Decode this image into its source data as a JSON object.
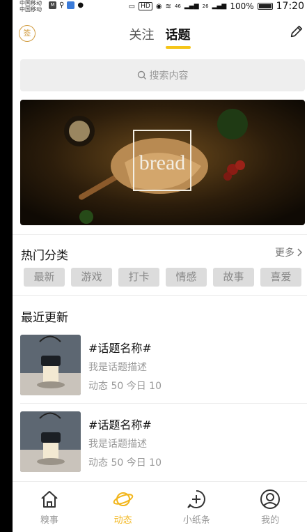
{
  "status_bar": {
    "carrier1": "中国移动",
    "carrier2": "中国移动",
    "hd": "HD",
    "signal1": "46",
    "signal2": "26",
    "battery_pct": "100%",
    "time": "17:20"
  },
  "header": {
    "sign_icon_text": "签",
    "tabs": [
      {
        "label": "关注",
        "active": false
      },
      {
        "label": "话题",
        "active": true
      }
    ]
  },
  "search": {
    "placeholder": "搜索内容"
  },
  "banner": {
    "text": "bread"
  },
  "hot": {
    "title": "热门分类",
    "more": "更多",
    "categories": [
      "最新",
      "游戏",
      "打卡",
      "情感",
      "故事",
      "喜爱"
    ]
  },
  "recent": {
    "title": "最近更新",
    "topics": [
      {
        "name": "#话题名称#",
        "desc": "我是话题描述",
        "stats": "动态 50 今日 10"
      },
      {
        "name": "#话题名称#",
        "desc": "我是话题描述",
        "stats": "动态 50 今日 10"
      }
    ]
  },
  "bottom_nav": {
    "items": [
      {
        "label": "糗事",
        "icon": "home-icon",
        "active": false
      },
      {
        "label": "动态",
        "icon": "planet-icon",
        "active": true
      },
      {
        "label": "小纸条",
        "icon": "chat-plus-icon",
        "active": false
      },
      {
        "label": "我的",
        "icon": "profile-icon",
        "active": false
      }
    ]
  },
  "colors": {
    "accent": "#f5c518",
    "nav_active": "#f2b51a",
    "sign": "#d09a3c"
  }
}
